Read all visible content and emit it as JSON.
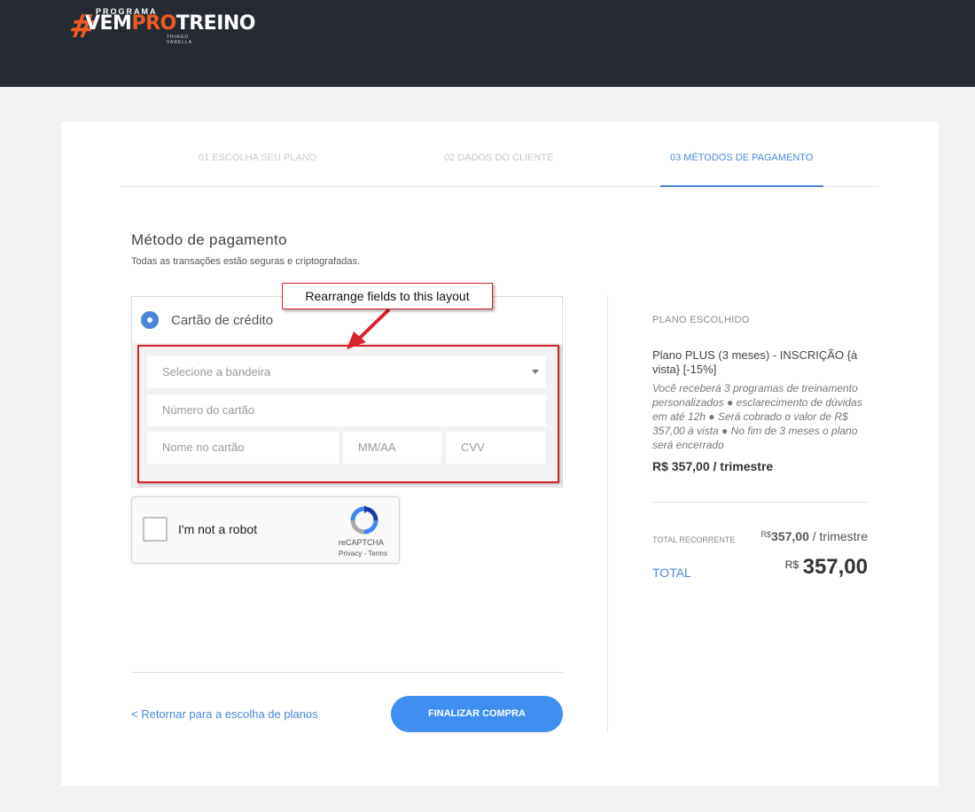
{
  "logo": {
    "hash": "#",
    "programa": "PROGRAMA",
    "vem": "VEM",
    "pro": "PRO",
    "treino": "TREINO",
    "author": "THIAGO VARELLA"
  },
  "steps": [
    {
      "label": "01 ESCOLHA SEU PLANO"
    },
    {
      "label": "02 DADOS DO CLIENTE"
    },
    {
      "label": "03 MÉTODOS DE PAGAMENTO"
    }
  ],
  "payment": {
    "title": "Método de pagamento",
    "subtitle": "Todas as transações estão seguras e criptografadas.",
    "option_label": "Cartão de crédito",
    "brand_placeholder": "Selecione a bandeira",
    "card_number_placeholder": "Número do cartão",
    "card_name_placeholder": "Nome no cartão",
    "expiry_placeholder": "MM/AA",
    "cvv_placeholder": "CVV"
  },
  "annotation": {
    "callout": "Rearrange fields to this layout"
  },
  "captcha": {
    "label": "I'm not a robot",
    "brand": "reCAPTCHA",
    "terms": "Privacy - Terms"
  },
  "actions": {
    "back_link": "< Retornar para a escolha de planos",
    "finalize": "FINALIZAR COMPRA"
  },
  "summary": {
    "label": "PLANO ESCOLHIDO",
    "plan_name": "Plano PLUS (3 meses) - INSCRIÇÃO {à vista} [-15%]",
    "plan_desc": "Você receberá 3 programas de treinamento personalizados ● esclarecimento de dúvidas em até 12h ● Será cobrado o valor de R$ 357,00 à vista ● No fim de 3 meses o plano será encerrado",
    "plan_price": "R$ 357,00 / trimestre",
    "recurring_label": "TOTAL RECORRENTE",
    "recurring_currency": "R$",
    "recurring_amount": "357,00",
    "recurring_period": " / trimestre",
    "total_label": "TOTAL",
    "total_currency": "R$",
    "total_amount": "357,00"
  },
  "colors": {
    "accent": "#4a86d8",
    "button": "#3f8ef0",
    "brand_orange": "#f05a22",
    "annotation_red": "#d8232a",
    "header_bg": "#262a33"
  }
}
